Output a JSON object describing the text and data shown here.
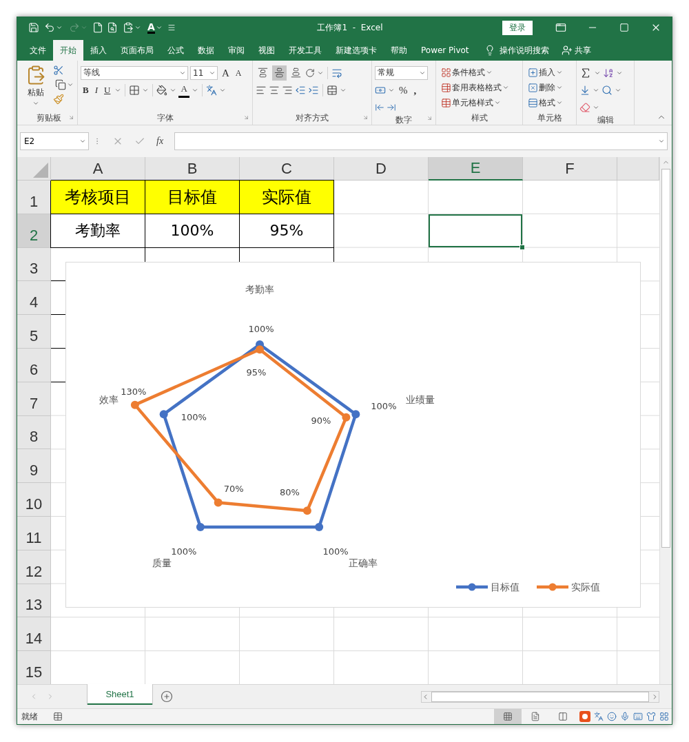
{
  "window": {
    "title": "工作簿1  -  Excel",
    "sign_in": "登录"
  },
  "quick_access": {
    "font_color": "A"
  },
  "tabs": [
    {
      "label": "文件",
      "selected": false
    },
    {
      "label": "开始",
      "selected": true
    },
    {
      "label": "插入",
      "selected": false
    },
    {
      "label": "页面布局",
      "selected": false
    },
    {
      "label": "公式",
      "selected": false
    },
    {
      "label": "数据",
      "selected": false
    },
    {
      "label": "审阅",
      "selected": false
    },
    {
      "label": "视图",
      "selected": false
    },
    {
      "label": "开发工具",
      "selected": false
    },
    {
      "label": "新建选项卡",
      "selected": false
    },
    {
      "label": "帮助",
      "selected": false
    },
    {
      "label": "Power Pivot",
      "selected": false
    }
  ],
  "tell_me": "操作说明搜索",
  "share": "共享",
  "ribbon": {
    "clipboard": {
      "label": "剪贴板",
      "paste": "粘贴"
    },
    "font": {
      "label": "字体",
      "font_name": "等线",
      "font_size": "11",
      "grow": "A",
      "shrink": "A",
      "bold": "B",
      "italic": "I",
      "underline": "U",
      "font_color": "A"
    },
    "alignment": {
      "label": "对齐方式",
      "vertical": [
        {
          "selected": false
        },
        {
          "selected": true
        },
        {
          "selected": false
        }
      ]
    },
    "number": {
      "label": "数字",
      "format": "常规",
      "percent": "%",
      "comma": ","
    },
    "styles": {
      "label": "样式",
      "items": [
        "条件格式",
        "套用表格格式",
        "单元格样式"
      ]
    },
    "cells": {
      "label": "单元格",
      "items": [
        "插入",
        "删除",
        "格式"
      ]
    },
    "editing": {
      "label": "编辑"
    }
  },
  "formula_bar": {
    "name_box": "E2",
    "fx": "fx"
  },
  "columns": [
    {
      "label": "A",
      "selected": false
    },
    {
      "label": "B",
      "selected": false
    },
    {
      "label": "C",
      "selected": false
    },
    {
      "label": "D",
      "selected": false
    },
    {
      "label": "E",
      "selected": true
    },
    {
      "label": "F",
      "selected": false
    }
  ],
  "rows": [
    {
      "label": "1",
      "selected": false,
      "kind": "header",
      "cells": [
        "考核项目",
        "目标值",
        "实际值"
      ]
    },
    {
      "label": "2",
      "selected": true,
      "kind": "data",
      "cells": [
        "考勤率",
        "100%",
        "95%"
      ]
    },
    {
      "label": "3",
      "selected": false,
      "kind": "blank_table"
    },
    {
      "label": "4",
      "selected": false,
      "kind": "blank_table"
    },
    {
      "label": "5",
      "selected": false,
      "kind": "blank_table"
    },
    {
      "label": "6",
      "selected": false,
      "kind": "blank_table"
    },
    {
      "label": "7",
      "selected": false,
      "kind": "plain"
    },
    {
      "label": "8",
      "selected": false,
      "kind": "plain"
    },
    {
      "label": "9",
      "selected": false,
      "kind": "plain"
    },
    {
      "label": "10",
      "selected": false,
      "kind": "plain"
    },
    {
      "label": "11",
      "selected": false,
      "kind": "plain"
    },
    {
      "label": "12",
      "selected": false,
      "kind": "plain"
    },
    {
      "label": "13",
      "selected": false,
      "kind": "plain"
    },
    {
      "label": "14",
      "selected": false,
      "kind": "plain"
    },
    {
      "label": "15",
      "selected": false,
      "kind": "plain"
    }
  ],
  "chart": {
    "kind": "radar",
    "categories": [
      "考勤率",
      "业绩量",
      "正确率",
      "质量",
      "效率"
    ],
    "series": [
      {
        "name": "目标值",
        "color": "#4472c4",
        "labels": [
          "100%",
          "100%",
          "100%",
          "100%",
          "100%"
        ]
      },
      {
        "name": "实际值",
        "color": "#ed7d31",
        "labels": [
          "95%",
          "90%",
          "80%",
          "70%",
          "130%"
        ]
      }
    ]
  },
  "sheet_tabs": [
    {
      "label": "Sheet1",
      "selected": true
    }
  ],
  "status_bar": {
    "text": "就绪",
    "views": [
      {
        "selected": true
      },
      {
        "selected": false
      },
      {
        "selected": false
      }
    ]
  }
}
